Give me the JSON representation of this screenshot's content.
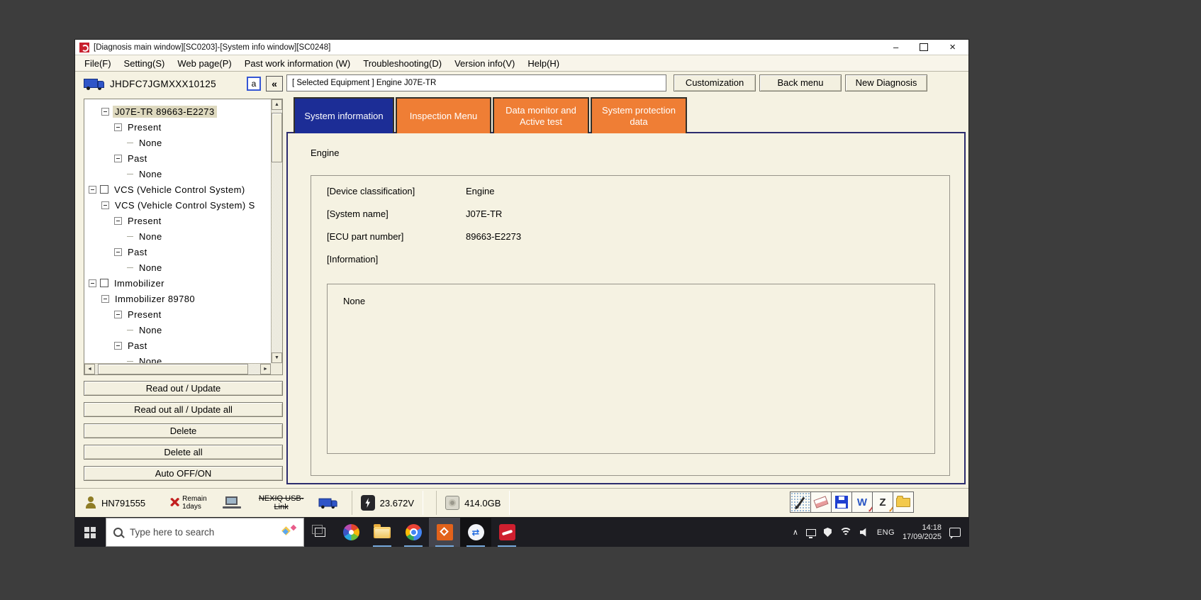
{
  "window": {
    "title": "[Diagnosis main window][SC0203]-[System info window][SC0248]"
  },
  "icons": {
    "minimize": "–",
    "close": "×",
    "collapse_panel": "«",
    "scroll_up": "▲",
    "scroll_down": "▼",
    "scroll_left": "◄",
    "scroll_right": "►",
    "tray_chevron": "∧",
    "error_x": "×",
    "word_letter": "W",
    "z_letter": "Z",
    "teamviewer_arrows": "⇄"
  },
  "menu_bar": {
    "items": [
      "File(F)",
      "Setting(S)",
      "Web page(P)",
      "Past work information (W)",
      "Troubleshooting(D)",
      "Version info(V)",
      "Help(H)"
    ]
  },
  "left_panel": {
    "vehicle_id": "JHDFC7JGMXXX10125",
    "font_toggle_label": "a",
    "tree": [
      {
        "label": "J07E-TR 89663-E2273",
        "level": 1,
        "expand": true,
        "selected": true
      },
      {
        "label": "Present",
        "level": 2,
        "expand": true
      },
      {
        "label": "None",
        "level": 3
      },
      {
        "label": "Past",
        "level": 2,
        "expand": true
      },
      {
        "label": "None",
        "level": 3
      },
      {
        "label": "VCS (Vehicle Control System)",
        "level": 0,
        "expand": true,
        "checkbox": true
      },
      {
        "label": "VCS (Vehicle Control System) S",
        "level": 1,
        "expand": true
      },
      {
        "label": "Present",
        "level": 2,
        "expand": true
      },
      {
        "label": "None",
        "level": 3
      },
      {
        "label": "Past",
        "level": 2,
        "expand": true
      },
      {
        "label": "None",
        "level": 3
      },
      {
        "label": "Immobilizer",
        "level": 0,
        "expand": true,
        "checkbox": true
      },
      {
        "label": "Immobilizer 89780",
        "level": 1,
        "expand": true
      },
      {
        "label": "Present",
        "level": 2,
        "expand": true
      },
      {
        "label": "None",
        "level": 3
      },
      {
        "label": "Past",
        "level": 2,
        "expand": true
      },
      {
        "label": "None",
        "level": 3
      }
    ],
    "buttons": [
      "Read out / Update",
      "Read out all / Update all",
      "Delete",
      "Delete all",
      "Auto OFF/ON"
    ]
  },
  "header": {
    "selected_equipment": "[ Selected Equipment ] Engine J07E-TR",
    "buttons": [
      "Customization",
      "Back menu",
      "New Diagnosis"
    ]
  },
  "tabs": [
    {
      "label": "System information",
      "active": true
    },
    {
      "label": "Inspection Menu",
      "active": false
    },
    {
      "label": "Data monitor and Active test",
      "active": false
    },
    {
      "label": "System protection data",
      "active": false
    }
  ],
  "content": {
    "section_title": "Engine",
    "fields": [
      {
        "label": "[Device classification]",
        "value": "Engine"
      },
      {
        "label": "[System name]",
        "value": "J07E-TR"
      },
      {
        "label": "[ECU part number]",
        "value": "89663-E2273"
      },
      {
        "label": "[Information]",
        "value": ""
      }
    ],
    "information_value": "None"
  },
  "status_bar": {
    "user_id": "HN791555",
    "remain_line1": "Remain",
    "remain_line2": "1days",
    "device_line1": "NEXIQ USB-",
    "device_line2": "Link",
    "voltage": "23.672V",
    "disk_space": "414.0GB"
  },
  "taskbar": {
    "search_placeholder": "Type here to search",
    "language": "ENG",
    "time": "14:18",
    "date": "17/09/2025"
  }
}
